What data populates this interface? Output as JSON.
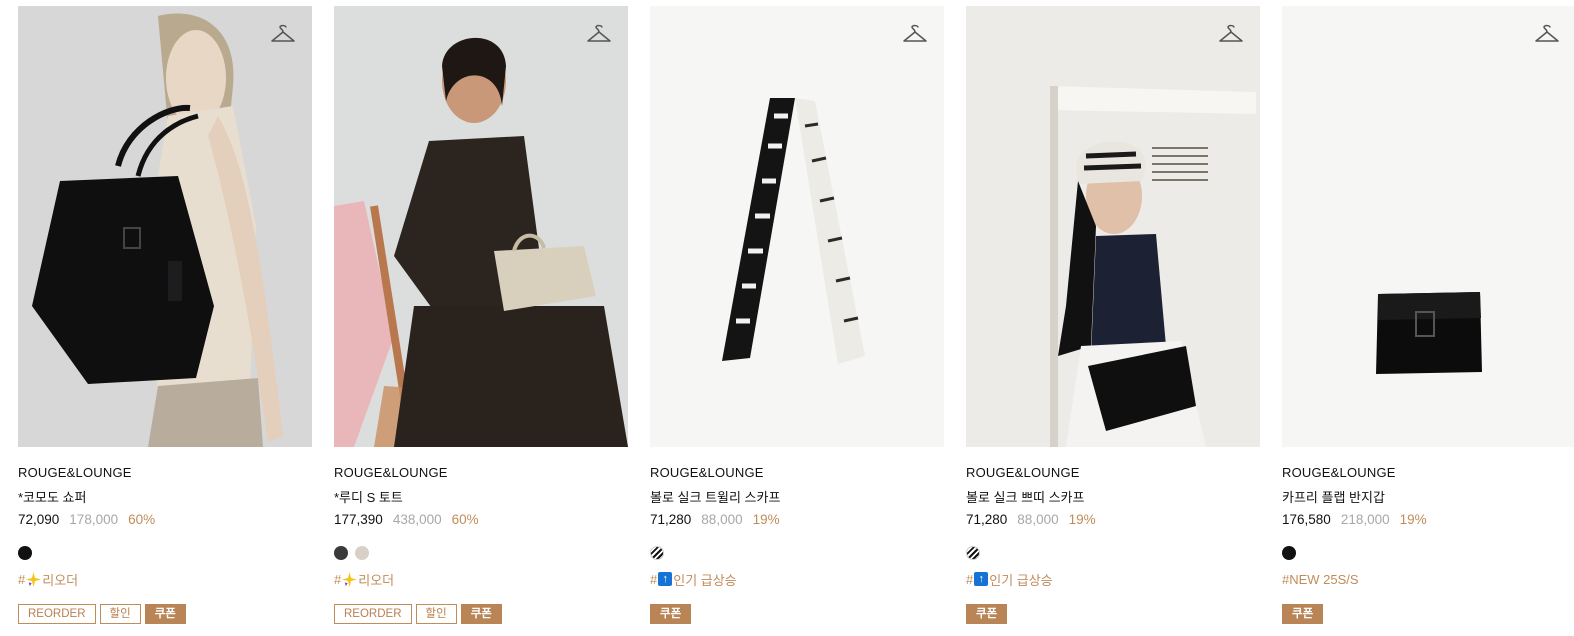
{
  "colors": {
    "accent": "#c08c5a",
    "coupon_bg": "#b98556",
    "price_original": "#a7a7a7"
  },
  "products": [
    {
      "brand": "ROUGE&LOUNGE",
      "name": "*코모도 쇼퍼",
      "sale_price": "72,090",
      "original_price": "178,000",
      "discount": "60%",
      "swatches": [
        "#111111"
      ],
      "tag_hash": "#",
      "tag_icon": "sparkle-icon",
      "tag_text": "리오더",
      "badges": [
        "REORDER",
        "할인",
        "쿠폰"
      ]
    },
    {
      "brand": "ROUGE&LOUNGE",
      "name": "*루디 S 토트",
      "sale_price": "177,390",
      "original_price": "438,000",
      "discount": "60%",
      "swatches": [
        "#3a3a3a",
        "#d8d0c6"
      ],
      "tag_hash": "#",
      "tag_icon": "sparkle-icon",
      "tag_text": "리오더",
      "badges": [
        "REORDER",
        "할인",
        "쿠폰"
      ]
    },
    {
      "brand": "ROUGE&LOUNGE",
      "name": "볼로 실크 트윌리 스카프",
      "sale_price": "71,280",
      "original_price": "88,000",
      "discount": "19%",
      "swatches": [
        "stripe"
      ],
      "tag_hash": "#",
      "tag_icon": "up-arrow-icon",
      "tag_text": "인기 급상승",
      "badges": [
        "쿠폰"
      ]
    },
    {
      "brand": "ROUGE&LOUNGE",
      "name": "볼로 실크 쁘띠 스카프",
      "sale_price": "71,280",
      "original_price": "88,000",
      "discount": "19%",
      "swatches": [
        "stripe"
      ],
      "tag_hash": "#",
      "tag_icon": "up-arrow-icon",
      "tag_text": "인기 급상승",
      "badges": [
        "쿠폰"
      ]
    },
    {
      "brand": "ROUGE&LOUNGE",
      "name": "카프리 플랩 반지갑",
      "sale_price": "176,580",
      "original_price": "218,000",
      "discount": "19%",
      "swatches": [
        "#111111"
      ],
      "tag_hash": "#NEW 25S/S",
      "tag_icon": "",
      "tag_text": "",
      "badges": [
        "쿠폰"
      ]
    }
  ]
}
